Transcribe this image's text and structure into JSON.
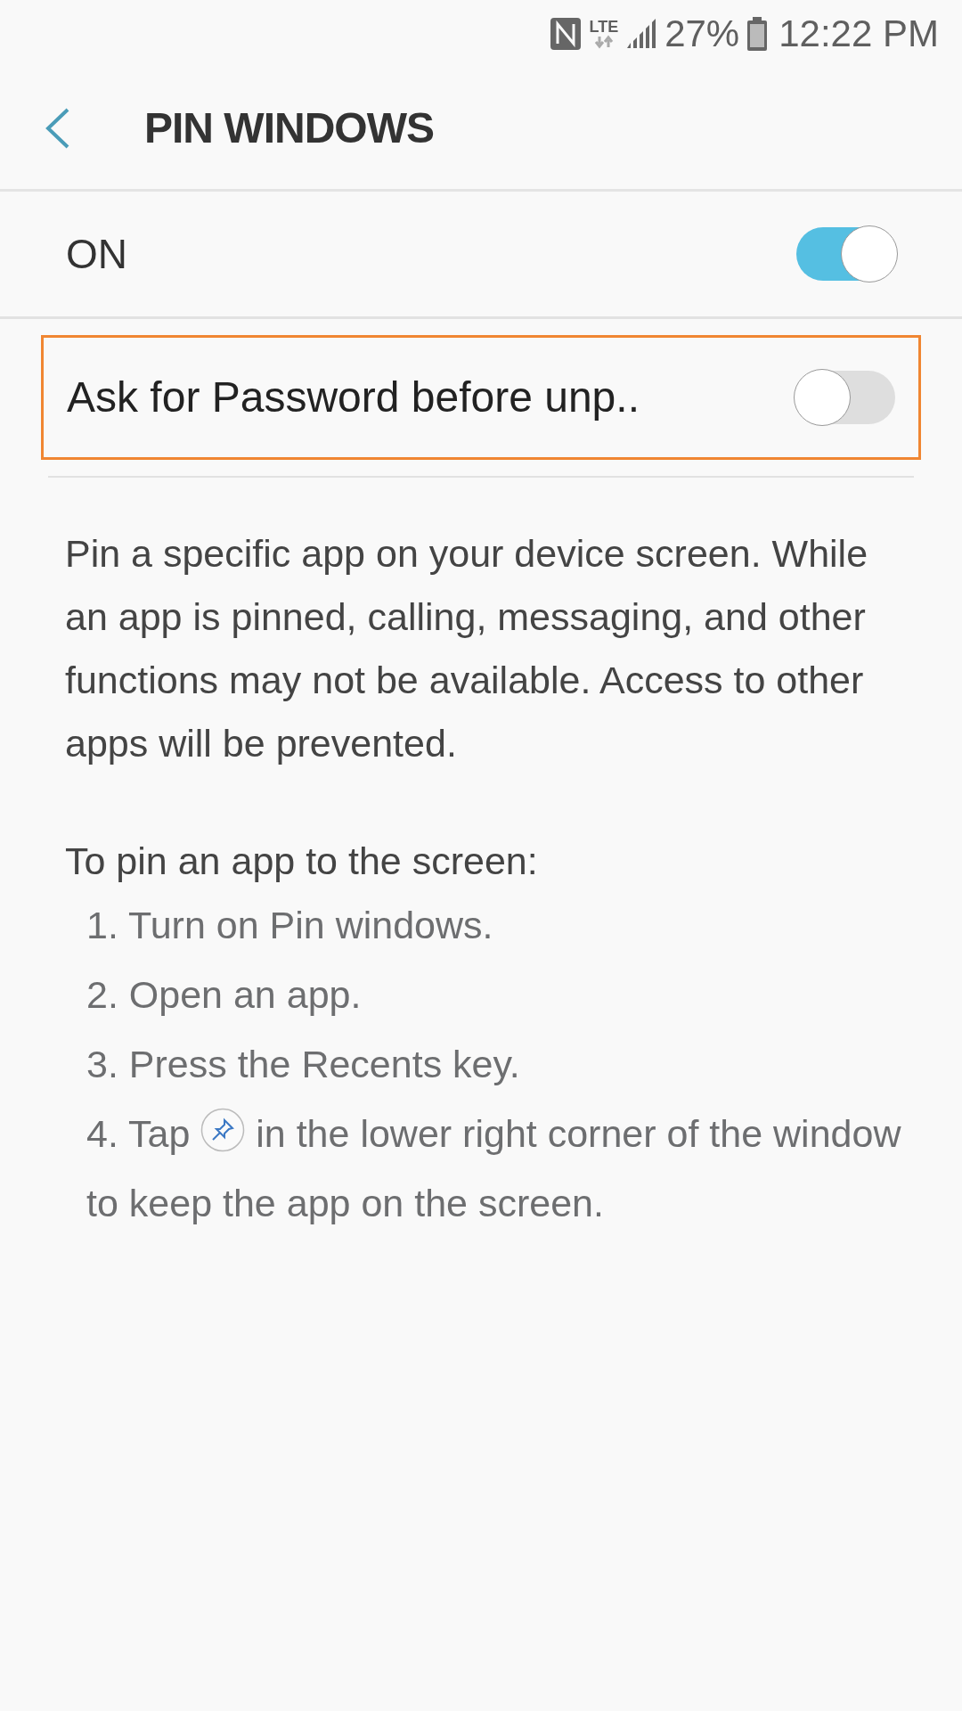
{
  "status_bar": {
    "network": "LTE",
    "battery": "27%",
    "time": "12:22 PM"
  },
  "header": {
    "title": "PIN WINDOWS"
  },
  "master_switch": {
    "label": "ON",
    "on": true
  },
  "settings": [
    {
      "label": "Ask for Password before unp..",
      "on": false,
      "highlighted": true
    }
  ],
  "description": "Pin a specific app on your device screen. While an app is pinned, calling, messaging, and other functions may not be available. Access to other apps will be prevented.",
  "steps_heading": "To pin an app to the screen:",
  "steps": [
    {
      "number": "1.",
      "text": "Turn on Pin windows."
    },
    {
      "number": "2.",
      "text": "Open an app."
    },
    {
      "number": "3.",
      "text": "Press the Recents key."
    },
    {
      "number": "4.",
      "text": "Tap",
      "text_after": "in the lower right corner of the window to keep the app on the screen.",
      "kind": "icon"
    }
  ]
}
